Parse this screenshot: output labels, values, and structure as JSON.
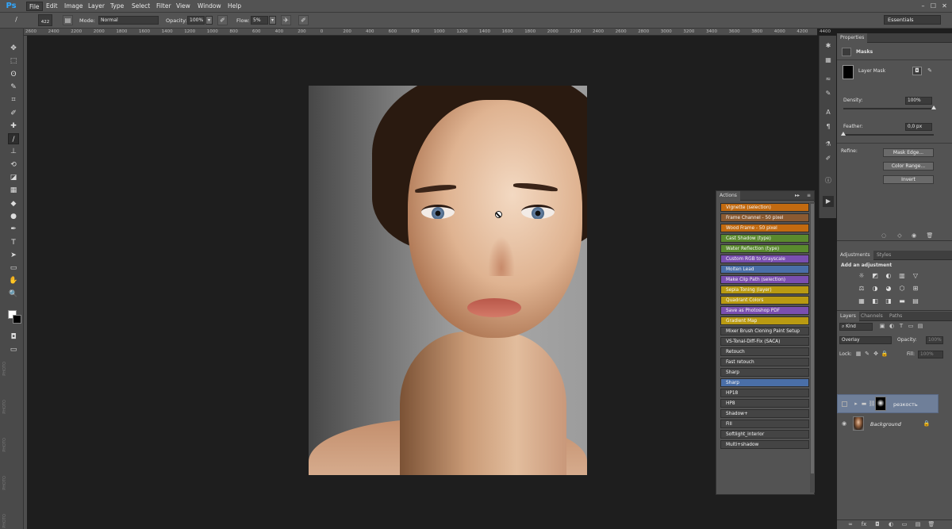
{
  "app": {
    "logo": "Ps"
  },
  "menu": [
    "File",
    "Edit",
    "Image",
    "Layer",
    "Type",
    "Select",
    "Filter",
    "View",
    "Window",
    "Help"
  ],
  "window_controls": [
    "–",
    "☐",
    "✕"
  ],
  "options_bar": {
    "brush_size": "422",
    "mode_label": "Mode:",
    "mode_value": "Normal",
    "opacity_label": "Opacity:",
    "opacity_value": "100%",
    "flow_label": "Flow:",
    "flow_value": "5%",
    "workspace": "Essentials"
  },
  "ruler_numbers": [
    "2600",
    "2400",
    "2200",
    "2000",
    "1800",
    "1600",
    "1400",
    "1200",
    "1000",
    "800",
    "600",
    "400",
    "200",
    "0",
    "200",
    "400",
    "600",
    "800",
    "1000",
    "1200",
    "1400",
    "1600",
    "1800",
    "2000",
    "2200",
    "2400",
    "2600",
    "2800",
    "3000",
    "3200",
    "3400",
    "3600",
    "3800",
    "4000",
    "4200",
    "4400"
  ],
  "tools": [
    "move-tool",
    "marquee-tool",
    "lasso-tool",
    "quick-select-tool",
    "crop-tool",
    "eyedropper-tool",
    "healing-tool",
    "brush-tool",
    "stamp-tool",
    "history-brush-tool",
    "eraser-tool",
    "gradient-tool",
    "blur-tool",
    "dodge-tool",
    "pen-tool",
    "type-tool",
    "path-select-tool",
    "shape-tool",
    "hand-tool",
    "zoom-tool"
  ],
  "tool_glyphs": [
    "✥",
    "⬚",
    "ʘ",
    "✎",
    "⌗",
    "✐",
    "✚",
    "/",
    "⊥",
    "⟲",
    "◪",
    "▦",
    "◆",
    "●",
    "✒",
    "T",
    "➤",
    "▭",
    "✋",
    "🔍"
  ],
  "side_labels": [
    "PHOTO",
    "PHOTO",
    "PHOTO",
    "PHOTO",
    "PHOTO"
  ],
  "actions_panel": {
    "title": "Actions",
    "items": [
      {
        "label": "Vignette (selection)",
        "color": "#c26a10"
      },
      {
        "label": "Frame Channel - 50 pixel",
        "color": "#8a5a32"
      },
      {
        "label": "Wood Frame - 50 pixel",
        "color": "#c26a10"
      },
      {
        "label": "Cast Shadow (type)",
        "color": "#5a8a2e"
      },
      {
        "label": "Water Reflection (type)",
        "color": "#5a8a2e"
      },
      {
        "label": "Custom RGB to Grayscale",
        "color": "#7a4fb0"
      },
      {
        "label": "Molten Lead",
        "color": "#4a6fa8"
      },
      {
        "label": "Make Clip Path (selection)",
        "color": "#7a4fb0"
      },
      {
        "label": "Sepia Toning (layer)",
        "color": "#b99a12"
      },
      {
        "label": "Quadrant Colors",
        "color": "#b99a12"
      },
      {
        "label": "Save as Photoshop PDF",
        "color": "#7a4fb0"
      },
      {
        "label": "Gradient Map",
        "color": "#b99a12"
      },
      {
        "label": "Mixer Brush Cloning Paint Setup",
        "color": "#444444"
      },
      {
        "label": "VS-Tonal-Diff-Fix (SACA)",
        "color": "#444444"
      },
      {
        "label": "Retouch",
        "color": "#444444"
      },
      {
        "label": "Fast retouch",
        "color": "#444444"
      },
      {
        "label": "Sharp",
        "color": "#444444"
      },
      {
        "label": "Sharp",
        "color": "#4a6fa8"
      },
      {
        "label": "HP18",
        "color": "#444444"
      },
      {
        "label": "HP8",
        "color": "#444444"
      },
      {
        "label": "Shadow+",
        "color": "#444444"
      },
      {
        "label": "Fill",
        "color": "#444444"
      },
      {
        "label": "Softlight_interior",
        "color": "#444444"
      },
      {
        "label": "Multi+shadow",
        "color": "#444444"
      }
    ]
  },
  "properties": {
    "tab": "Properties",
    "section": "Masks",
    "mask_type": "Layer Mask",
    "density_label": "Density:",
    "density_value": "100%",
    "density_level": 1.0,
    "feather_label": "Feather:",
    "feather_value": "0,0 px",
    "feather_level": 0.0,
    "refine_label": "Refine:",
    "buttons": [
      "Mask Edge...",
      "Color Range...",
      "Invert"
    ]
  },
  "adjustments": {
    "tabs": [
      "Adjustments",
      "Styles"
    ],
    "heading": "Add an adjustment",
    "icons": [
      "☼",
      "◩",
      "◐",
      "▥",
      "▽",
      "⚖",
      "◑",
      "◕",
      "⬡",
      "⊞",
      "▦",
      "◧",
      "◨",
      "▬",
      "▤"
    ]
  },
  "layers": {
    "tabs": [
      "Layers",
      "Channels",
      "Paths"
    ],
    "kind_label": "Kind",
    "blend_mode": "Overlay",
    "opacity_label": "Opacity:",
    "opacity_value": "100%",
    "lock_label": "Lock:",
    "fill_label": "Fill:",
    "fill_value": "100%",
    "rows": [
      {
        "name": "резкость",
        "type": "group"
      },
      {
        "name": "Background",
        "type": "image"
      }
    ],
    "footer_icons": [
      "∞",
      "fx",
      "◘",
      "◐",
      "▭",
      "▤",
      "🗑"
    ]
  }
}
